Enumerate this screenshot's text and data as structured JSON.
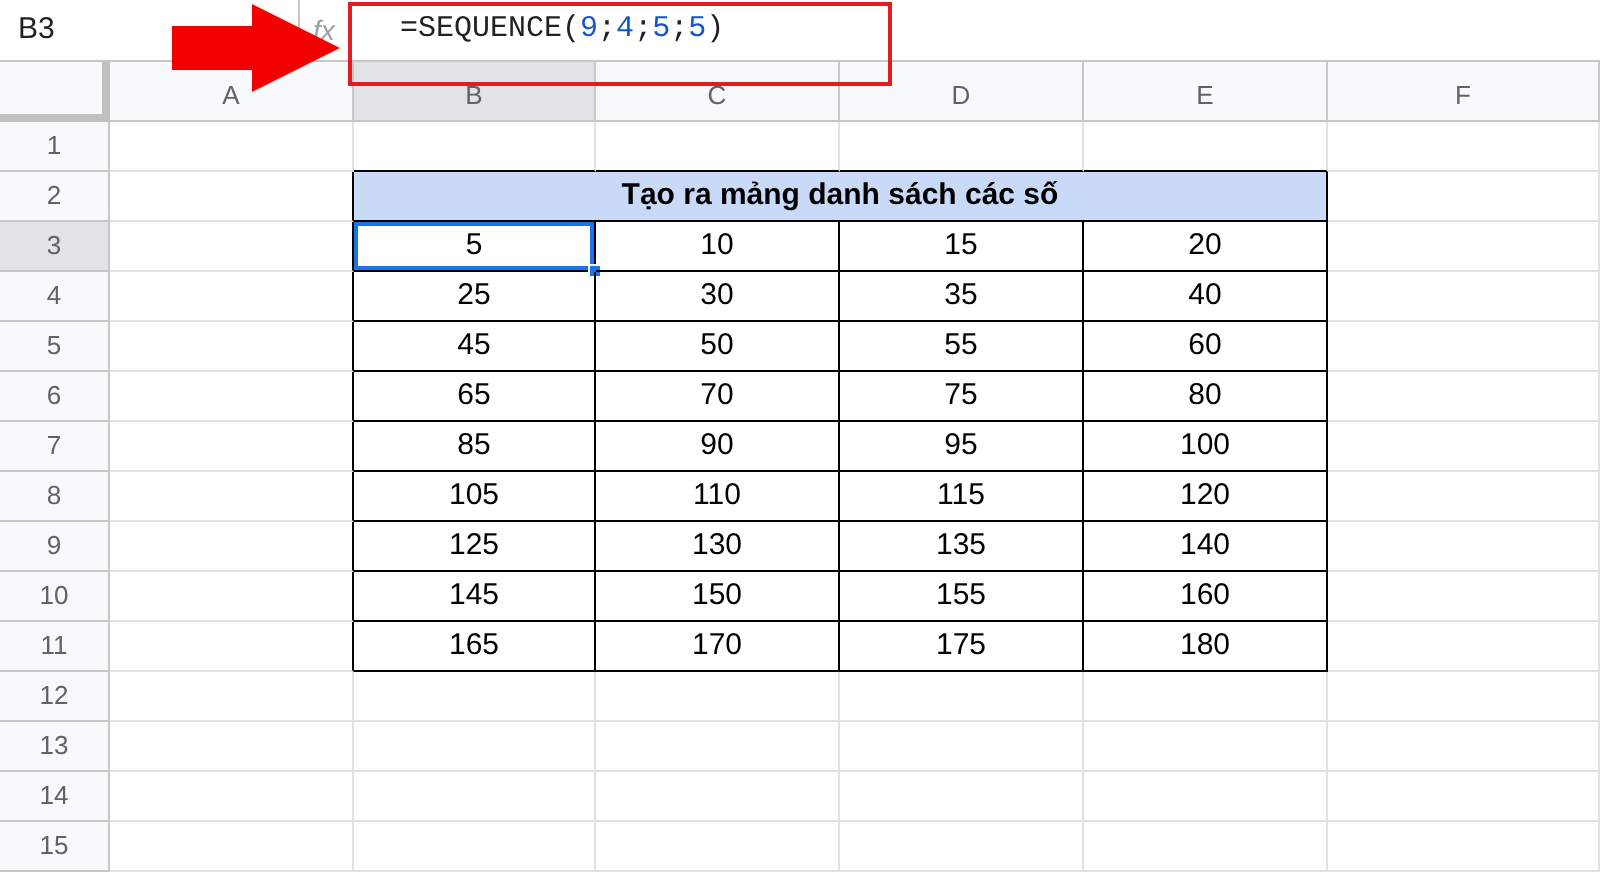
{
  "name_box": "B3",
  "fx_label": "fx",
  "formula": [
    {
      "text": "=SEQUENCE(",
      "kind": "plain"
    },
    {
      "text": "9",
      "kind": "number"
    },
    {
      "text": ";",
      "kind": "plain"
    },
    {
      "text": "4",
      "kind": "number"
    },
    {
      "text": ";",
      "kind": "plain"
    },
    {
      "text": "5",
      "kind": "number"
    },
    {
      "text": ";",
      "kind": "plain"
    },
    {
      "text": "5",
      "kind": "number"
    },
    {
      "text": ")",
      "kind": "plain"
    }
  ],
  "columns": [
    {
      "label": "A",
      "selected": false
    },
    {
      "label": "B",
      "selected": true
    },
    {
      "label": "C",
      "selected": false
    },
    {
      "label": "D",
      "selected": false
    },
    {
      "label": "E",
      "selected": false
    },
    {
      "label": "F",
      "selected": false
    }
  ],
  "rows": [
    {
      "label": "1",
      "selected": false
    },
    {
      "label": "2",
      "selected": false
    },
    {
      "label": "3",
      "selected": true
    },
    {
      "label": "4",
      "selected": false
    },
    {
      "label": "5",
      "selected": false
    },
    {
      "label": "6",
      "selected": false
    },
    {
      "label": "7",
      "selected": false
    },
    {
      "label": "8",
      "selected": false
    },
    {
      "label": "9",
      "selected": false
    },
    {
      "label": "10",
      "selected": false
    },
    {
      "label": "11",
      "selected": false
    },
    {
      "label": "12",
      "selected": false
    },
    {
      "label": "13",
      "selected": false
    },
    {
      "label": "14",
      "selected": false
    },
    {
      "label": "15",
      "selected": false
    }
  ],
  "table": {
    "title": "Tạo ra mảng danh sách các số",
    "rows": [
      [
        {
          "value": "5",
          "selected": true
        },
        {
          "value": "10",
          "selected": false
        },
        {
          "value": "15",
          "selected": false
        },
        {
          "value": "20",
          "selected": false
        }
      ],
      [
        {
          "value": "25",
          "selected": false
        },
        {
          "value": "30",
          "selected": false
        },
        {
          "value": "35",
          "selected": false
        },
        {
          "value": "40",
          "selected": false
        }
      ],
      [
        {
          "value": "45",
          "selected": false
        },
        {
          "value": "50",
          "selected": false
        },
        {
          "value": "55",
          "selected": false
        },
        {
          "value": "60",
          "selected": false
        }
      ],
      [
        {
          "value": "65",
          "selected": false
        },
        {
          "value": "70",
          "selected": false
        },
        {
          "value": "75",
          "selected": false
        },
        {
          "value": "80",
          "selected": false
        }
      ],
      [
        {
          "value": "85",
          "selected": false
        },
        {
          "value": "90",
          "selected": false
        },
        {
          "value": "95",
          "selected": false
        },
        {
          "value": "100",
          "selected": false
        }
      ],
      [
        {
          "value": "105",
          "selected": false
        },
        {
          "value": "110",
          "selected": false
        },
        {
          "value": "115",
          "selected": false
        },
        {
          "value": "120",
          "selected": false
        }
      ],
      [
        {
          "value": "125",
          "selected": false
        },
        {
          "value": "130",
          "selected": false
        },
        {
          "value": "135",
          "selected": false
        },
        {
          "value": "140",
          "selected": false
        }
      ],
      [
        {
          "value": "145",
          "selected": false
        },
        {
          "value": "150",
          "selected": false
        },
        {
          "value": "155",
          "selected": false
        },
        {
          "value": "160",
          "selected": false
        }
      ],
      [
        {
          "value": "165",
          "selected": false
        },
        {
          "value": "170",
          "selected": false
        },
        {
          "value": "175",
          "selected": false
        },
        {
          "value": "180",
          "selected": false
        }
      ]
    ]
  }
}
